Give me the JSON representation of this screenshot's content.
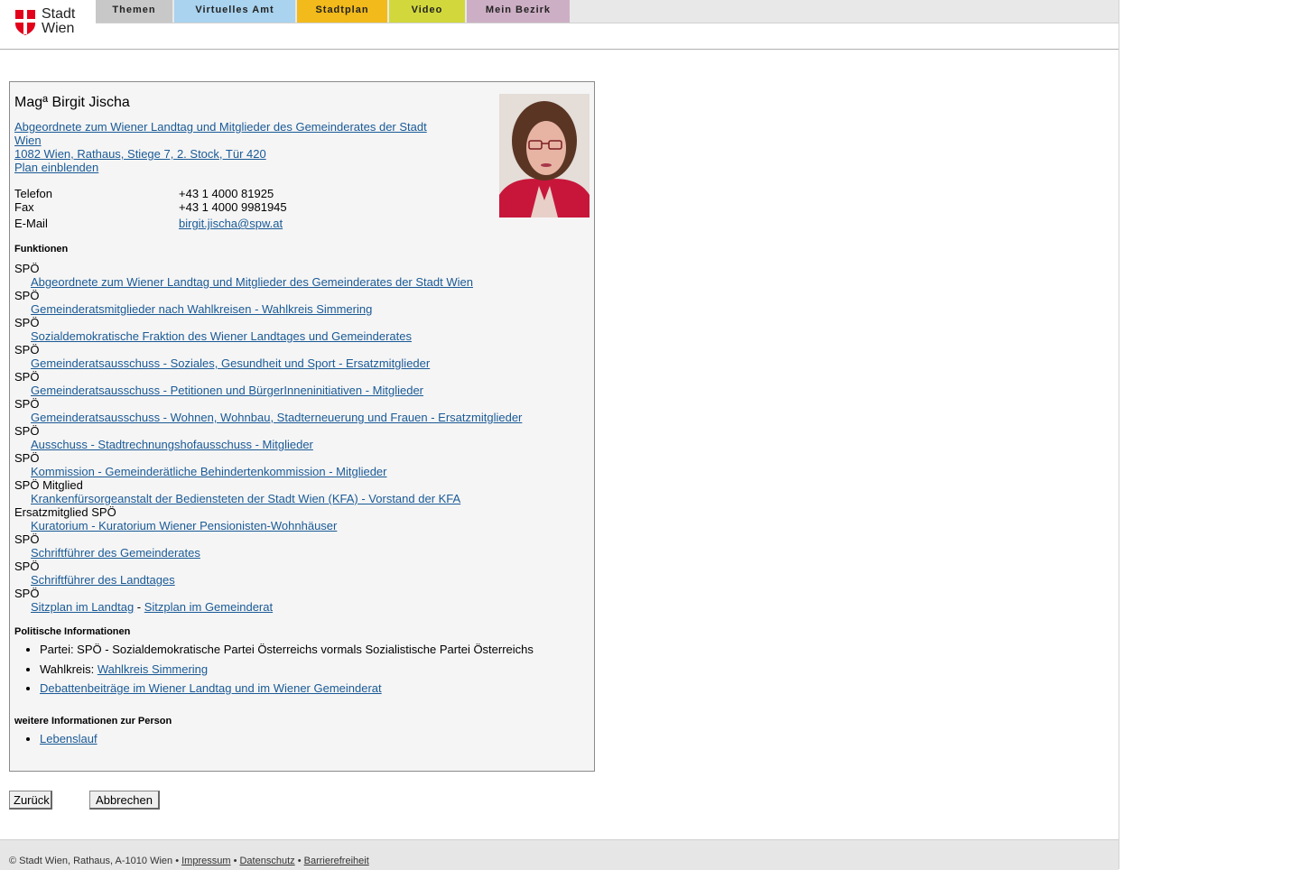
{
  "logo": {
    "line1": "Stadt",
    "line2": "Wien"
  },
  "nav": {
    "tabs": [
      {
        "label": "Themen",
        "color": "#c8c8c8"
      },
      {
        "label": "Virtuelles Amt",
        "color": "#a9d3ef"
      },
      {
        "label": "Stadtplan",
        "color": "#f2ba1a"
      },
      {
        "label": "Video",
        "color": "#d2d83b"
      },
      {
        "label": "Mein Bezirk",
        "color": "#cdafc5"
      }
    ]
  },
  "person": {
    "name": "Magª Birgit Jischa",
    "role_link_line1": "Abgeordnete zum Wiener Landtag und Mitglieder des Gemeinderates der Stadt",
    "role_link_line2": "Wien ",
    "address_link": "1082 Wien, Rathaus, Stiege 7, 2. Stock, Tür 420",
    "plan_link": "Plan einblenden",
    "contact": [
      {
        "label": "Telefon",
        "value": "+43 1 4000 81925"
      },
      {
        "label": "Fax",
        "value": "+43 1 4000 9981945"
      },
      {
        "label": "E-Mail",
        "value": "birgit.jischa@spw.at"
      }
    ]
  },
  "functions": {
    "title": "Funktionen",
    "items": [
      {
        "party": "SPÖ",
        "link": "Abgeordnete zum Wiener Landtag und Mitglieder des Gemeinderates der Stadt Wien"
      },
      {
        "party": "SPÖ",
        "link": "Gemeinderatsmitglieder nach Wahlkreisen - Wahlkreis Simmering"
      },
      {
        "party": "SPÖ",
        "link": "Sozialdemokratische Fraktion des Wiener Landtages und Gemeinderates"
      },
      {
        "party": "SPÖ",
        "link": "Gemeinderatsausschuss - Soziales, Gesundheit und Sport - Ersatzmitglieder"
      },
      {
        "party": "SPÖ",
        "link": "Gemeinderatsausschuss - Petitionen und BürgerInneninitiativen - Mitglieder"
      },
      {
        "party": "SPÖ",
        "link": "Gemeinderatsausschuss - Wohnen, Wohnbau, Stadterneuerung und Frauen - Ersatzmitglieder"
      },
      {
        "party": "SPÖ",
        "link": "Ausschuss - Stadtrechnungshofausschuss - Mitglieder"
      },
      {
        "party": "SPÖ",
        "link": "Kommission - Gemeinderätliche Behindertenkommission - Mitglieder"
      },
      {
        "party": "SPÖ Mitglied",
        "link": "Krankenfürsorgeanstalt der Bediensteten der Stadt Wien (KFA) - Vorstand der KFA"
      },
      {
        "party": "Ersatzmitglied SPÖ",
        "link": "Kuratorium - Kuratorium Wiener Pensionisten-Wohnhäuser"
      },
      {
        "party": "SPÖ",
        "link": "Schriftführer des Gemeinderates"
      },
      {
        "party": "SPÖ",
        "link": "Schriftführer des Landtages"
      }
    ],
    "last_party": "SPÖ",
    "seat_link1": "Sitzplan im Landtag",
    "seat_sep": " - ",
    "seat_link2": "Sitzplan im Gemeinderat"
  },
  "political": {
    "title": "Politische Informationen",
    "party_text": "Partei: SPÖ - Sozialdemokratische Partei Österreichs vormals Sozialistische Partei Österreichs",
    "district_label": "Wahlkreis: ",
    "district_link": "Wahlkreis Simmering",
    "debates_link": "Debattenbeiträge im Wiener Landtag und im Wiener Gemeinderat"
  },
  "more": {
    "title": "weitere Informationen zur Person",
    "cv_link": "Lebenslauf"
  },
  "buttons": {
    "back": "Zurück",
    "cancel": "Abbrechen"
  },
  "footer": {
    "copyright": "© Stadt Wien, Rathaus, A-1010 Wien • ",
    "impressum": "Impressum",
    "sep": " • ",
    "datenschutz": "Datenschutz",
    "barrierefreiheit": "Barrierefreiheit"
  }
}
